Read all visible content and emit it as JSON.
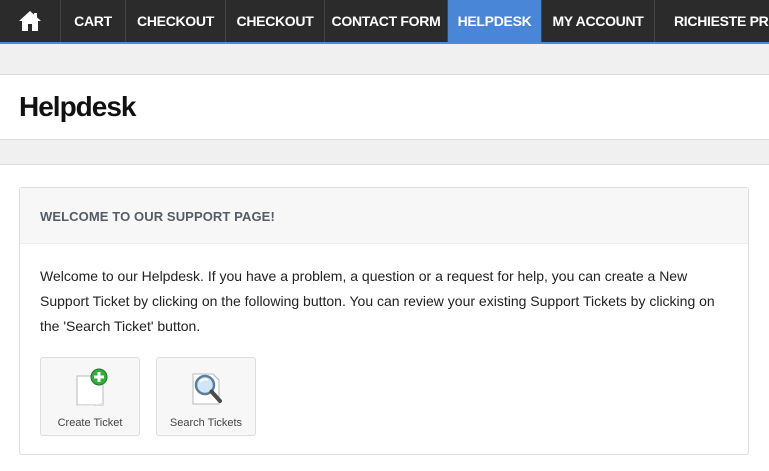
{
  "nav": {
    "home_icon": "home-icon",
    "items": [
      {
        "label": "CART"
      },
      {
        "label": "CHECKOUT"
      },
      {
        "label": "CHECKOUT"
      },
      {
        "label": "CONTACT FORM"
      },
      {
        "label": "HELPDESK",
        "active": true
      },
      {
        "label": "MY ACCOUNT"
      },
      {
        "label": "RICHIESTE PREVENTIVI"
      }
    ],
    "colors": {
      "bar": "#2b2b2b",
      "active": "#4a86d8"
    }
  },
  "page": {
    "title": "Helpdesk"
  },
  "panel": {
    "heading": "WELCOME TO OUR SUPPORT PAGE!",
    "intro": "Welcome to our Helpdesk. If you have a problem, a question or a request for help, you can create a New Support Ticket by clicking on the following button. You can review your existing Support Tickets by clicking on the 'Search Ticket' button.",
    "actions": [
      {
        "label": "Create Ticket",
        "icon": "document-add-icon"
      },
      {
        "label": "Search Tickets",
        "icon": "magnifier-document-icon"
      }
    ]
  }
}
